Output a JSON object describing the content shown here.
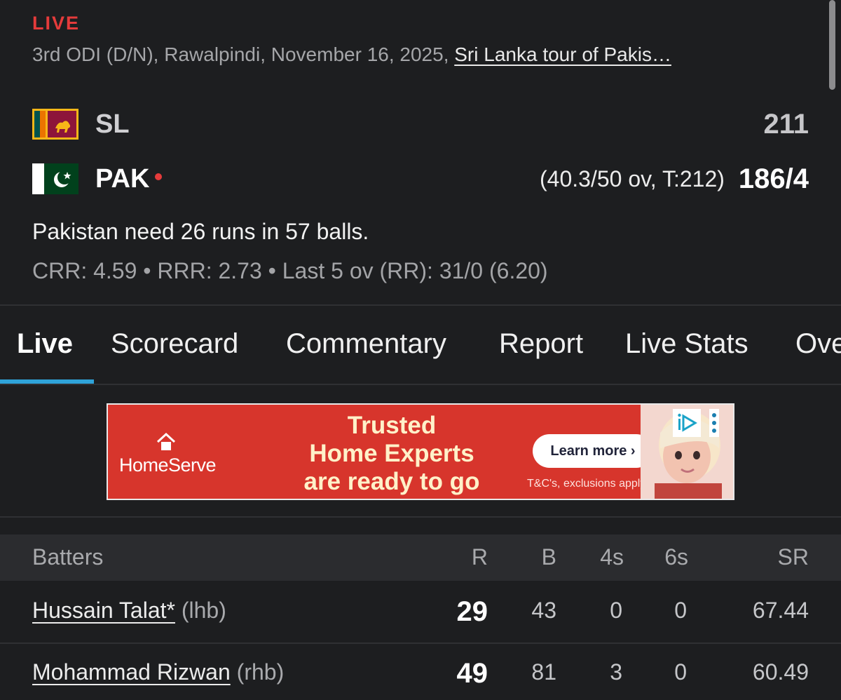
{
  "match": {
    "status_tag": "LIVE",
    "info": "3rd ODI (D/N), Rawalpindi, November 16, 2025, ",
    "series": "Sri Lanka tour of Pakis…",
    "teams": [
      {
        "abbr": "SL",
        "flag_icon": "sri-lanka-flag-icon",
        "overs_info": "",
        "score": "211",
        "batting": false
      },
      {
        "abbr": "PAK",
        "flag_icon": "pakistan-flag-icon",
        "overs_info": "(40.3/50 ov, T:212)",
        "score": "186/4",
        "batting": true
      }
    ],
    "status_text": "Pakistan need 26 runs in 57 balls.",
    "rates": "CRR: 4.59 • RRR: 2.73 • Last 5 ov (RR): 31/0 (6.20)"
  },
  "tabs": [
    "Live",
    "Scorecard",
    "Commentary",
    "Report",
    "Live Stats",
    "Ove"
  ],
  "active_tab": "Live",
  "ad": {
    "brand": "HomeServe",
    "headline": [
      "Trusted",
      "Home Experts",
      "are ready to go"
    ],
    "cta": "Learn more ›",
    "terms": "T&C's, exclusions apply"
  },
  "batters": {
    "headers": {
      "name": "Batters",
      "r": "R",
      "b": "B",
      "fours": "4s",
      "sixes": "6s",
      "sr": "SR"
    },
    "rows": [
      {
        "name": "Hussain Talat*",
        "hand": "(lhb)",
        "r": "29",
        "b": "43",
        "fours": "0",
        "sixes": "0",
        "sr": "67.44"
      },
      {
        "name": "Mohammad Rizwan",
        "hand": "(rhb)",
        "r": "49",
        "b": "81",
        "fours": "3",
        "sixes": "0",
        "sr": "60.49"
      }
    ]
  },
  "colors": {
    "background": "#1d1e20",
    "live": "#e53b3b",
    "accent": "#2fa3d9",
    "ad_red": "#d7352c"
  }
}
